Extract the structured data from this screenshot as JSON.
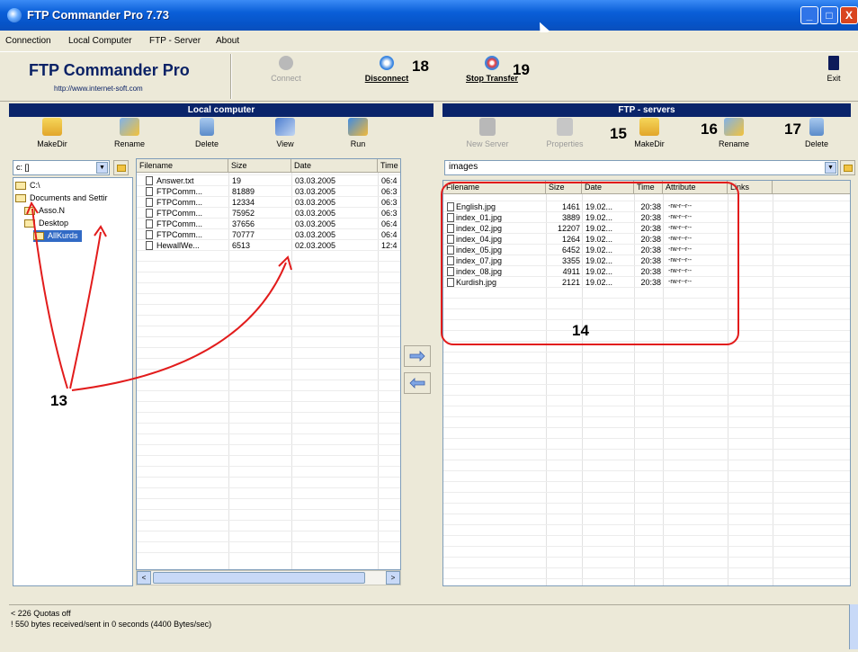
{
  "window": {
    "title": "FTP Commander Pro 7.73",
    "controls": {
      "minimize": "_",
      "maximize": "□",
      "close": "X"
    }
  },
  "menu": [
    "Connection",
    "Local Computer",
    "FTP - Server",
    "About"
  ],
  "brand": {
    "name": "FTP Commander Pro",
    "url": "http://www.internet-soft.com"
  },
  "toolbar": {
    "connect": "Connect",
    "disconnect": "Disconnect",
    "stop_transfer": "Stop Transfer",
    "exit": "Exit"
  },
  "callouts": {
    "c13": "13",
    "c14": "14",
    "c15": "15",
    "c16": "16",
    "c17": "17",
    "c18": "18",
    "c19": "19"
  },
  "local": {
    "header": "Local computer",
    "tools": {
      "makedir": "MakeDir",
      "rename": "Rename",
      "delete": "Delete",
      "view": "View",
      "run": "Run"
    },
    "drive": "c: []",
    "tree": [
      "C:\\",
      "Documents and Settir",
      "Asso.N",
      "Desktop",
      "AllKurds"
    ],
    "columns": [
      "Filename",
      "Size",
      "Date",
      "Time"
    ],
    "files": [
      {
        "name": "Answer.txt",
        "size": "19",
        "date": "03.03.2005",
        "time": "06:4"
      },
      {
        "name": "FTPComm...",
        "size": "81889",
        "date": "03.03.2005",
        "time": "06:3"
      },
      {
        "name": "FTPComm...",
        "size": "12334",
        "date": "03.03.2005",
        "time": "06:3"
      },
      {
        "name": "FTPComm...",
        "size": "75952",
        "date": "03.03.2005",
        "time": "06:3"
      },
      {
        "name": "FTPComm...",
        "size": "37656",
        "date": "03.03.2005",
        "time": "06:4"
      },
      {
        "name": "FTPComm...",
        "size": "70777",
        "date": "03.03.2005",
        "time": "06:4"
      },
      {
        "name": "HewallWe...",
        "size": "6513",
        "date": "02.03.2005",
        "time": "12:4"
      }
    ],
    "scroll_left": "<",
    "scroll_right": ">"
  },
  "ftp": {
    "header": "FTP - servers",
    "tools": {
      "new_server": "New Server",
      "properties": "Properties",
      "makedir": "MakeDir",
      "rename": "Rename",
      "delete": "Delete"
    },
    "path": "images",
    "columns": [
      "Filename",
      "Size",
      "Date",
      "Time",
      "Attribute",
      "Links"
    ],
    "files": [
      {
        "name": "English.jpg",
        "size": "1461",
        "date": "19.02...",
        "time": "20:38",
        "attr": "-rw-r--r--"
      },
      {
        "name": "index_01.jpg",
        "size": "3889",
        "date": "19.02...",
        "time": "20:38",
        "attr": "-rw-r--r--"
      },
      {
        "name": "index_02.jpg",
        "size": "12207",
        "date": "19.02...",
        "time": "20:38",
        "attr": "-rw-r--r--"
      },
      {
        "name": "index_04.jpg",
        "size": "1264",
        "date": "19.02...",
        "time": "20:38",
        "attr": "-rw-r--r--"
      },
      {
        "name": "index_05.jpg",
        "size": "6452",
        "date": "19.02...",
        "time": "20:38",
        "attr": "-rw-r--r--"
      },
      {
        "name": "index_07.jpg",
        "size": "3355",
        "date": "19.02...",
        "time": "20:38",
        "attr": "-rw-r--r--"
      },
      {
        "name": "index_08.jpg",
        "size": "4911",
        "date": "19.02...",
        "time": "20:38",
        "attr": "-rw-r--r--"
      },
      {
        "name": "Kurdish.jpg",
        "size": "2121",
        "date": "19.02...",
        "time": "20:38",
        "attr": "-rw-r--r--"
      }
    ]
  },
  "status": {
    "line1": "< 226 Quotas off",
    "line2": "! 550 bytes received/sent in 0 seconds (4400 Bytes/sec)"
  },
  "colors": {
    "header_bg": "#0a246a",
    "annotation": "#e21c1c",
    "selection": "#316ac5"
  }
}
